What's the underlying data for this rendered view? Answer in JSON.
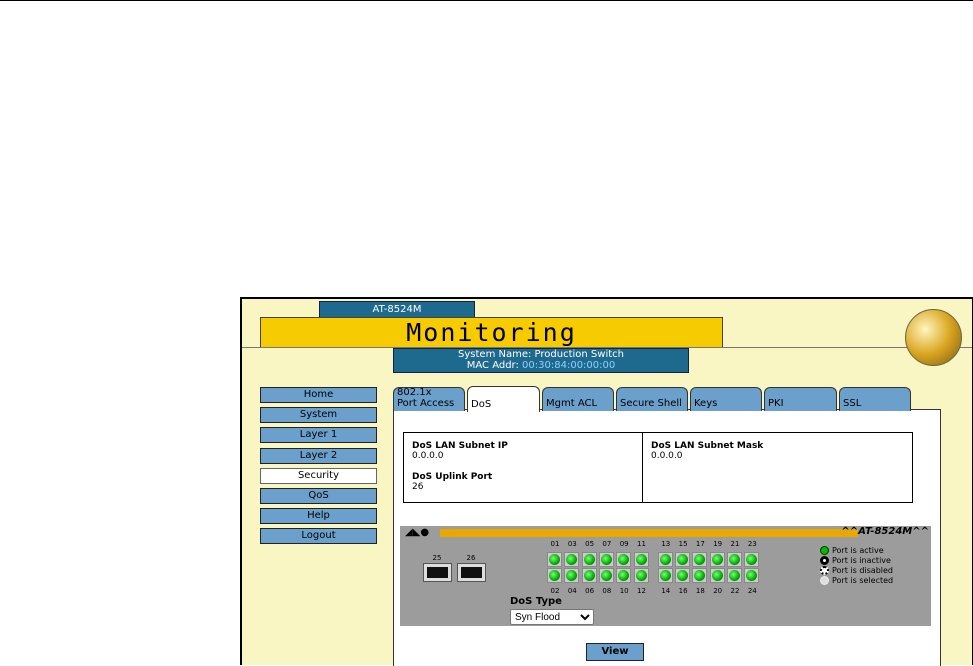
{
  "header": {
    "model_tab": "AT-8524M",
    "title": "Monitoring",
    "system_name": "System Name: Production Switch",
    "mac_label": "MAC Addr: ",
    "mac_value": "00:30:84:00:00:00"
  },
  "nav": [
    {
      "label": "Home"
    },
    {
      "label": "System"
    },
    {
      "label": "Layer 1"
    },
    {
      "label": "Layer 2"
    },
    {
      "label": "Security",
      "active": true
    },
    {
      "label": "QoS"
    },
    {
      "label": "Help"
    },
    {
      "label": "Logout"
    }
  ],
  "tabs": [
    {
      "line1": "802.1x",
      "line2": "Port Access"
    },
    {
      "line1": "",
      "line2": "DoS",
      "active": true
    },
    {
      "line1": "",
      "line2": "Mgmt ACL"
    },
    {
      "line1": "",
      "line2": "Secure Shell"
    },
    {
      "line1": "",
      "line2": "Keys"
    },
    {
      "line1": "",
      "line2": "PKI"
    },
    {
      "line1": "",
      "line2": "SSL"
    }
  ],
  "info": {
    "subnet_ip_label": "DoS LAN Subnet IP",
    "subnet_ip": "0.0.0.0",
    "subnet_mask_label": "DoS LAN Subnet Mask",
    "subnet_mask": "0.0.0.0",
    "uplink_label": "DoS Uplink Port",
    "uplink": "26"
  },
  "switch": {
    "model": "^^AT-8524M^^",
    "sfp_ports": [
      "25",
      "26"
    ],
    "top_ports": [
      "01",
      "03",
      "05",
      "07",
      "09",
      "11",
      "13",
      "15",
      "17",
      "19",
      "21",
      "23"
    ],
    "bottom_ports": [
      "02",
      "04",
      "06",
      "08",
      "10",
      "12",
      "14",
      "16",
      "18",
      "20",
      "22",
      "24"
    ],
    "legend": {
      "active": "Port is active",
      "inactive": "Port is inactive",
      "disabled": "Port is disabled",
      "selected": "Port is selected"
    }
  },
  "dos_type": {
    "label": "DoS Type",
    "value": "Syn Flood"
  },
  "view_label": "View"
}
